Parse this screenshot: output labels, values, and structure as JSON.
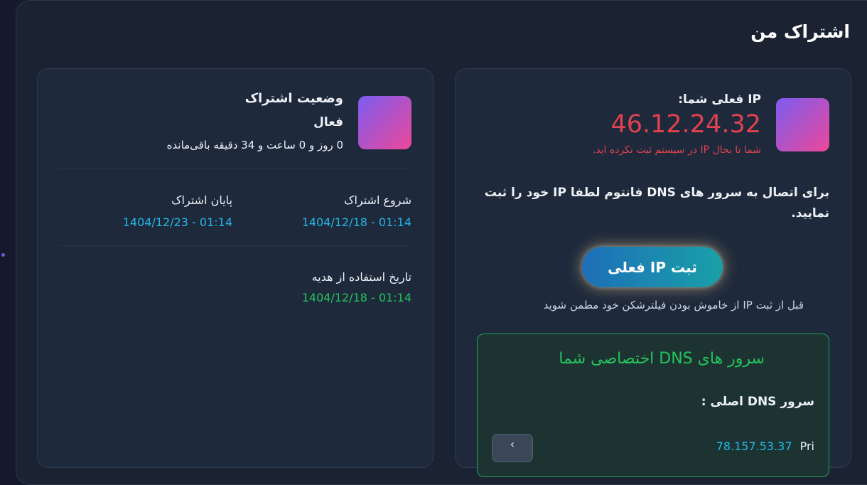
{
  "page": {
    "title": "اشتراک من"
  },
  "ip_card": {
    "label": "IP فعلی شما:",
    "ip": "46.12.24.32",
    "warning": "شما تا بحال IP در سیستم ثبت نکرده اید.",
    "instruction": "برای اتصال به سرور های DNS فانتوم لطفا IP خود را ثبت نمایید.",
    "submit_label": "ثبت IP فعلی",
    "note": "قبل از ثبت IP از خاموش بودن فیلترشکن خود مطمن شوید",
    "dns": {
      "title": "سرور های DNS اختصاصی شما",
      "primary_label": "سرور DNS اصلی :",
      "primary_value": "78.157.53.37",
      "primary_prefix": "Pri"
    }
  },
  "subscription": {
    "status_title": "وضعیت اشتراک",
    "status_value": "فعال",
    "remaining": "0  روز و 0 ساعت و 34 دقیقه باقی‌مانده",
    "start_label": "شروع اشتراک",
    "start_value": "1404/12/18 - 01:14",
    "end_label": "پایان اشتراک",
    "end_value": "1404/12/23 - 01:14",
    "gift_label": "تاریخ استفاده از هدیه",
    "gift_value": "1404/12/18 - 01:14"
  },
  "colors": {
    "accent_red": "#e0424f",
    "accent_cyan": "#22b8e8",
    "accent_green": "#22c55e"
  }
}
